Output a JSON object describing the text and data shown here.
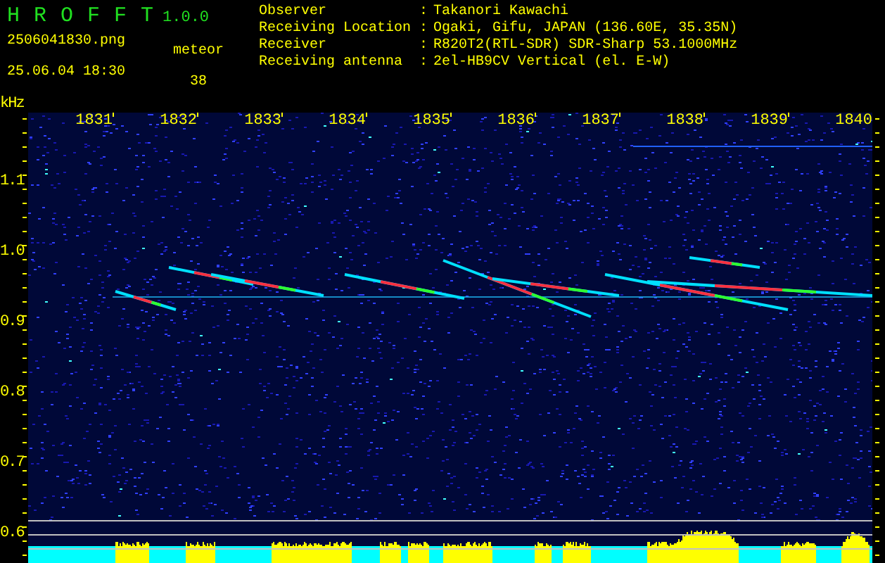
{
  "header": {
    "title": "H R O F F T",
    "version": "1.0.0",
    "filename": "2506041830.png",
    "datetime": "25.06.04 18:30",
    "meteor_label": "meteor",
    "meteor_count": "38",
    "info": [
      {
        "label": "Observer",
        "separator": ":",
        "value": "Takanori Kawachi"
      },
      {
        "label": "Receiving Location",
        "separator": ":",
        "value": "Ogaki, Gifu, JAPAN (136.60E, 35.35N)"
      },
      {
        "label": "Receiver",
        "separator": ":",
        "value": "R820T2(RTL-SDR) SDR-Sharp 53.1000MHz"
      },
      {
        "label": "Receiving antenna",
        "separator": ":",
        "value": "2el-HB9CV Vertical (el. E-W)"
      }
    ]
  },
  "spectrogram": {
    "unit": "kHz",
    "x_labels": [
      "1831",
      "1832",
      "1833",
      "1834",
      "1835",
      "1836",
      "1837",
      "1838",
      "1839",
      "1840"
    ],
    "y_labels": [
      "1.1",
      "1.0",
      "0.9",
      "0.8",
      "0.7",
      "0.6"
    ]
  }
}
